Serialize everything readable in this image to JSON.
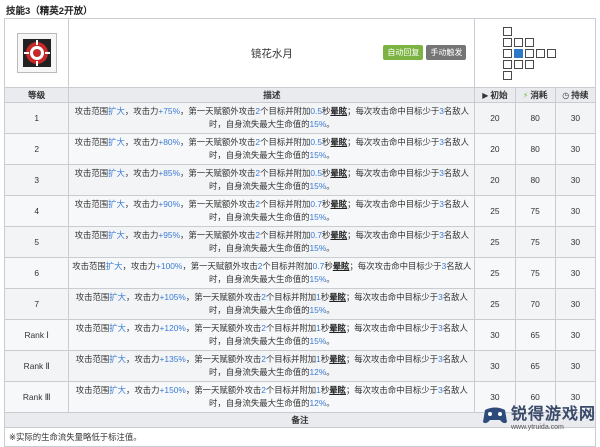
{
  "section_title": "技能3（精英2开放）",
  "skill": {
    "name": "镜花水月",
    "badges": [
      {
        "label": "自动回复",
        "color": "#7cb342"
      },
      {
        "label": "手动触发",
        "color": "#757575"
      }
    ],
    "icon": "skill-emblem-icon"
  },
  "headers": {
    "level": "等级",
    "desc": "描述",
    "init": "初始",
    "cost": "消耗",
    "duration": "持续"
  },
  "rows": [
    {
      "level": "1",
      "desc_parts": [
        "攻击范围",
        "扩大",
        "，攻击力",
        "+75%",
        "，第一天赋额外攻击",
        "2",
        "个目标并附加",
        "0.5",
        "秒",
        "晕眩",
        "；每次攻击命中目标少于",
        "3",
        "名敌人时，自身流失最大生命值的",
        "15%",
        "。"
      ],
      "init": "20",
      "cost": "80",
      "duration": "30"
    },
    {
      "level": "2",
      "desc_parts": [
        "攻击范围",
        "扩大",
        "，攻击力",
        "+80%",
        "，第一天赋额外攻击",
        "2",
        "个目标并附加",
        "0.5",
        "秒",
        "晕眩",
        "；每次攻击命中目标少于",
        "3",
        "名敌人时，自身流失最大生命值的",
        "15%",
        "。"
      ],
      "init": "20",
      "cost": "80",
      "duration": "30"
    },
    {
      "level": "3",
      "desc_parts": [
        "攻击范围",
        "扩大",
        "，攻击力",
        "+85%",
        "，第一天赋额外攻击",
        "2",
        "个目标并附加",
        "0.5",
        "秒",
        "晕眩",
        "；每次攻击命中目标少于",
        "3",
        "名敌人时，自身流失最大生命值的",
        "15%",
        "。"
      ],
      "init": "20",
      "cost": "80",
      "duration": "30"
    },
    {
      "level": "4",
      "desc_parts": [
        "攻击范围",
        "扩大",
        "，攻击力",
        "+90%",
        "，第一天赋额外攻击",
        "2",
        "个目标并附加",
        "0.7",
        "秒",
        "晕眩",
        "；每次攻击命中目标少于",
        "3",
        "名敌人时，自身流失最大生命值的",
        "15%",
        "。"
      ],
      "init": "25",
      "cost": "75",
      "duration": "30"
    },
    {
      "level": "5",
      "desc_parts": [
        "攻击范围",
        "扩大",
        "，攻击力",
        "+95%",
        "，第一天赋额外攻击",
        "2",
        "个目标并附加",
        "0.7",
        "秒",
        "晕眩",
        "；每次攻击命中目标少于",
        "3",
        "名敌人时，自身流失最大生命值的",
        "15%",
        "。"
      ],
      "init": "25",
      "cost": "75",
      "duration": "30"
    },
    {
      "level": "6",
      "desc_parts": [
        "攻击范围",
        "扩大",
        "，攻击力",
        "+100%",
        "，第一天赋额外攻击",
        "2",
        "个目标并附加",
        "0.7",
        "秒",
        "晕眩",
        "；每次攻击命中目标少于",
        "3",
        "名敌人时，自身流失最大生命值的",
        "15%",
        "。"
      ],
      "init": "25",
      "cost": "75",
      "duration": "30",
      "center": true
    },
    {
      "level": "7",
      "desc_parts": [
        "攻击范围",
        "扩大",
        "，攻击力",
        "+105%",
        "，第一天赋额外攻击",
        "2",
        "个目标并附加",
        "1",
        "秒",
        "晕眩",
        "；每次攻击命中目标少于",
        "3",
        "名敌人时，自身流失最大生命值的",
        "15%",
        "。"
      ],
      "init": "25",
      "cost": "70",
      "duration": "30"
    },
    {
      "level": "Rank Ⅰ",
      "desc_parts": [
        "攻击范围",
        "扩大",
        "，攻击力",
        "+120%",
        "，第一天赋额外攻击",
        "2",
        "个目标并附加",
        "1",
        "秒",
        "晕眩",
        "；每次攻击命中目标少于",
        "3",
        "名敌人时，自身流失最大生命值的",
        "15%",
        "。"
      ],
      "init": "30",
      "cost": "65",
      "duration": "30"
    },
    {
      "level": "Rank Ⅱ",
      "desc_parts": [
        "攻击范围",
        "扩大",
        "，攻击力",
        "+135%",
        "，第一天赋额外攻击",
        "2",
        "个目标并附加",
        "1",
        "秒",
        "晕眩",
        "；每次攻击命中目标少于",
        "3",
        "名敌人时，自身流失最大生命值的",
        "12%",
        "。"
      ],
      "init": "30",
      "cost": "65",
      "duration": "30"
    },
    {
      "level": "Rank Ⅲ",
      "desc_parts": [
        "攻击范围",
        "扩大",
        "，攻击力",
        "+150%",
        "，第一天赋额外攻击",
        "2",
        "个目标并附加",
        "1",
        "秒",
        "晕眩",
        "；每次攻击命中目标少于",
        "3",
        "名敌人时，自身流失最大生命值的",
        "12%",
        "。"
      ],
      "init": "30",
      "cost": "60",
      "duration": "30"
    }
  ],
  "notes_header": "备注",
  "note": "※实际的生命流失量略低于标注值。",
  "range_grid": [
    [
      1,
      0,
      0,
      0,
      0,
      0
    ],
    [
      1,
      1,
      1,
      0,
      0,
      0
    ],
    [
      1,
      2,
      1,
      1,
      1,
      0
    ],
    [
      1,
      1,
      1,
      0,
      0,
      0
    ],
    [
      1,
      0,
      0,
      0,
      0,
      0
    ]
  ],
  "watermark": {
    "text": "锐得游戏网",
    "url": "www.ytruida.com"
  },
  "colors": {
    "accent_blue": "#3a7bd5",
    "auto_badge": "#7cb342",
    "manual_badge": "#757575"
  }
}
